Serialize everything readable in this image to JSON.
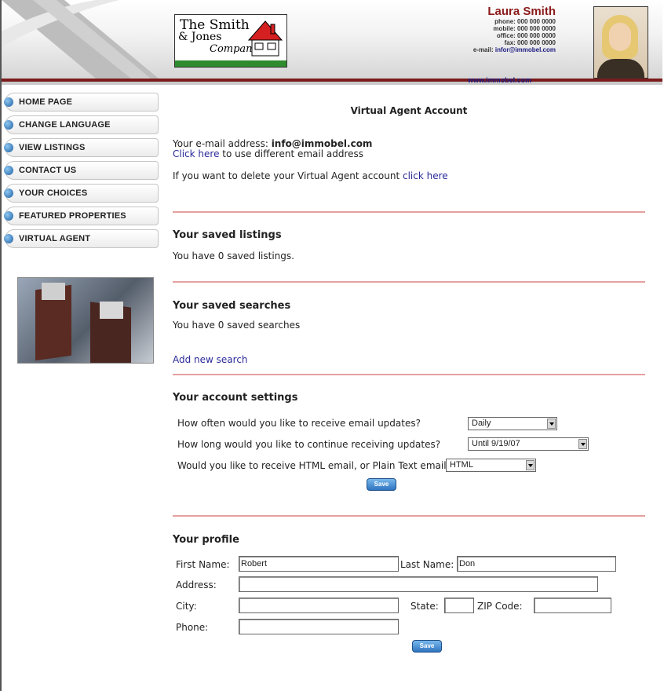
{
  "header": {
    "logo_line1": "The Smith",
    "logo_line2": "& Jones",
    "logo_line3": "Company",
    "agent_name": "Laura Smith",
    "phone": "phone: 000 000 0000",
    "mobile": "mobile: 000 000 0000",
    "office": "office: 000 000 0000",
    "fax": "fax: 000 000 0000",
    "email_label": "e-mail:",
    "email": "infor@immobel.com",
    "website": "www.immobel.com"
  },
  "nav": {
    "items": [
      {
        "label": "HOME PAGE"
      },
      {
        "label": "CHANGE LANGUAGE"
      },
      {
        "label": "VIEW LISTINGS"
      },
      {
        "label": "CONTACT US"
      },
      {
        "label": "YOUR CHOICES"
      },
      {
        "label": "FEATURED PROPERTIES"
      },
      {
        "label": "VIRTUAL AGENT"
      }
    ]
  },
  "main": {
    "title": "Virtual Agent Account",
    "email_prefix": "Your e-mail address:",
    "email_value": "info@immobel.com",
    "change_link": "Click here",
    "change_suffix": " to use different email address",
    "delete_prefix": "If you want to delete your Virtual Agent account ",
    "delete_link": "click here",
    "saved_listings_title": "Your saved listings",
    "saved_listings_text": "You have 0 saved listings.",
    "saved_searches_title": "Your saved searches",
    "saved_searches_text": "You have 0 saved searches",
    "add_search_link": "Add new search",
    "settings_title": "Your account settings",
    "settings": {
      "q1": "How often would you like to receive email updates?",
      "q1_value": "Daily",
      "q2": "How long would you like to continue receiving updates?",
      "q2_value": "Until 9/19/07",
      "q3": "Would you like to receive HTML email, or Plain Text email?",
      "q3_value": "HTML",
      "save": "Save"
    },
    "profile_title": "Your profile",
    "profile": {
      "first_name_label": "First Name:",
      "first_name": "Robert",
      "last_name_label": "Last Name:",
      "last_name": "Don",
      "address_label": "Address:",
      "address": "",
      "city_label": "City:",
      "city": "",
      "state_label": "State:",
      "state": "",
      "zip_label": "ZIP Code:",
      "zip": "",
      "phone_label": "Phone:",
      "phone": "",
      "save": "Save"
    }
  }
}
